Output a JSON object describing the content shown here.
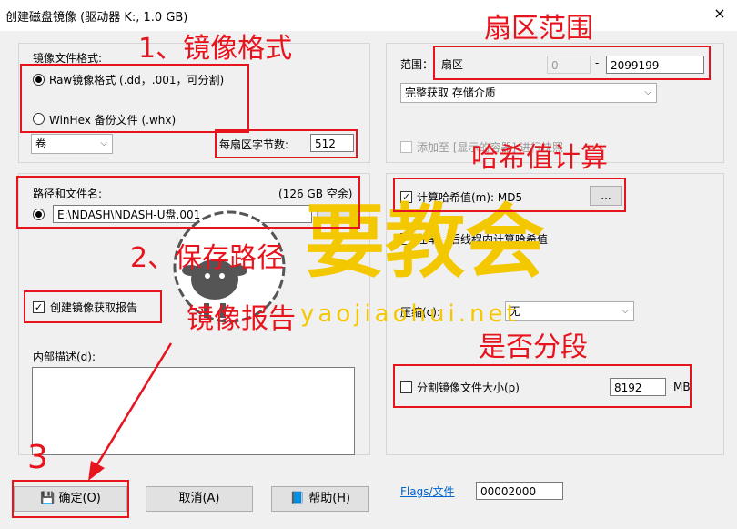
{
  "window": {
    "title": "创建磁盘镜像 (驱动器 K:, 1.0 GB)",
    "close_label": "×"
  },
  "left": {
    "format_group_label": "镜像文件格式:",
    "format_options": [
      "Raw镜像格式 (.dd，.001，可分割)",
      "WinHex 备份文件 (.whx)"
    ],
    "volume_select": "卷",
    "bytes_per_sector_label": "每扇区字节数:",
    "bytes_per_sector_value": "512",
    "path_label": "路径和文件名:",
    "free_space": "(126 GB 空余)",
    "path_value": "E:\\NDASH\\NDASH-U盘.001",
    "create_report_label": "创建镜像获取报告",
    "description_label": "内部描述(d):"
  },
  "right": {
    "range_label": "范围：",
    "range_unit": "扇区",
    "range_start": "0",
    "range_dash": "-",
    "range_end": "2099199",
    "acquire_select": "完整获取 存储介质",
    "add_to_label": "添加至 [显示的容器] 进行快照",
    "hash_label": "计算哈希值(m): MD5",
    "hash_btn": "...",
    "hash_thread_label": "在单一后线程内计算哈希值",
    "compress_label": "压缩(c):",
    "compress_value": "无",
    "split_label": "分割镜像文件大小(p)",
    "split_value": "8192",
    "split_unit": "MB",
    "flags_label": "Flags/文件",
    "flags_value": "00002000"
  },
  "buttons": {
    "ok": "确定(O)",
    "cancel": "取消(A)",
    "help": "帮助(H)"
  },
  "annotations": {
    "a1": "1、镜像格式",
    "a2": "扇区范围",
    "a3": "哈希值计算",
    "a4": "2、保存路径",
    "a5": "镜像报告",
    "a6": "是否分段",
    "a7": "3"
  },
  "watermark": {
    "text": "要教会",
    "url": "yaojiaohui.net"
  },
  "colors": {
    "annotation_red": "#e8141d",
    "watermark_yellow": "#f4c800"
  }
}
